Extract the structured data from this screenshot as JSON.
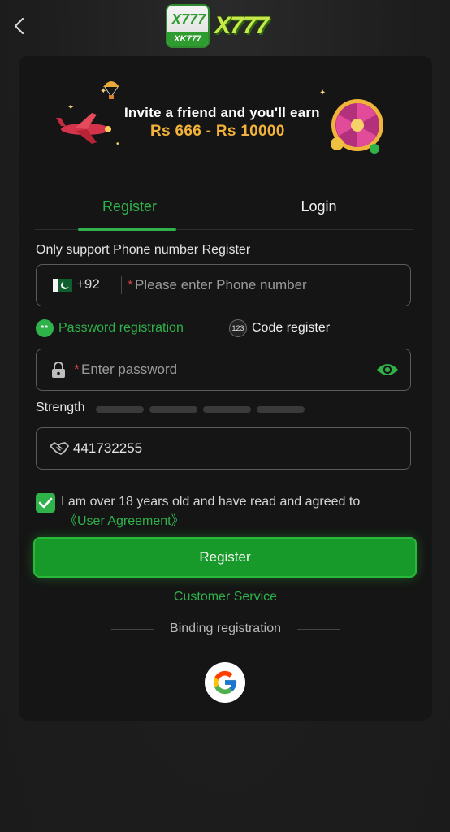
{
  "header": {
    "logo_badge_top": "X777",
    "logo_badge_bottom": "XK777",
    "logo_word": "X777"
  },
  "banner": {
    "invite_text": "Invite a friend and you'll earn",
    "amount_text": "Rs 666 - Rs 10000"
  },
  "tabs": [
    {
      "label": "Register",
      "active": true
    },
    {
      "label": "Login",
      "active": false
    }
  ],
  "form": {
    "hint": "Only support Phone number Register",
    "country_code": "+92",
    "required_mark": "*",
    "phone_placeholder": "Please enter Phone number",
    "options": {
      "password_label": "Password registration",
      "password_icon_text": "**",
      "code_label": "Code register",
      "code_icon_text": "123"
    },
    "password_placeholder": "Enter password",
    "strength_label": "Strength",
    "strength_level": 0,
    "invite_code_value": "441732255",
    "agreement_text": "I am over 18 years old and have read and agreed to",
    "agreement_link": "《User Agreement》",
    "agreement_checked": true,
    "register_button": "Register"
  },
  "footer": {
    "customer_service": "Customer Service",
    "binding_registration": "Binding registration"
  },
  "colors": {
    "accent": "#2fb24a",
    "background": "#1e1e1e",
    "card": "#151515",
    "required": "#d94141",
    "banner_amount": "#f3b23a"
  },
  "icons": [
    "back-chevron-icon",
    "pakistan-flag-icon",
    "lock-icon",
    "eye-icon",
    "handshake-icon",
    "check-icon",
    "google-icon"
  ]
}
